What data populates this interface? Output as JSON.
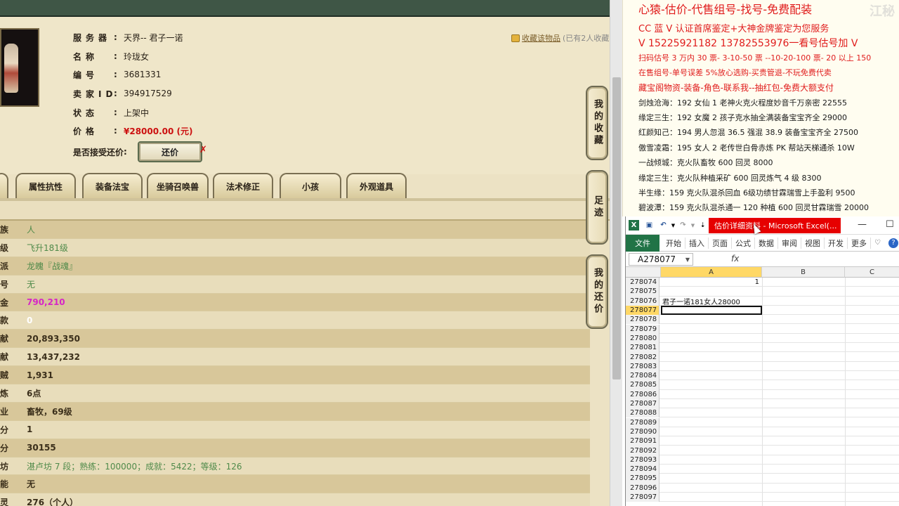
{
  "game": {
    "collect": {
      "link": "收藏该物品",
      "count": "(已有2人收藏"
    },
    "info": [
      {
        "label": "服务器",
        "value": "天界-- 君子一诺"
      },
      {
        "label": "名称",
        "value": "玲珑女"
      },
      {
        "label": "编号",
        "value": "3681331"
      },
      {
        "label": "卖家ID",
        "value": "394917529"
      },
      {
        "label": "状态",
        "value": "上架中"
      },
      {
        "label": "价格",
        "value": "¥28000.00 (元)"
      },
      {
        "label": "是否接受还价",
        "value": ""
      }
    ],
    "bargain_button": "还价",
    "bargain_close": "✗",
    "tabs": [
      "属性抗性",
      "装备法宝",
      "坐骑召唤兽",
      "法术修正",
      "小孩",
      "外观道具"
    ],
    "attributes": [
      {
        "label": "族",
        "value": "人"
      },
      {
        "label": "级",
        "value": "飞升181级"
      },
      {
        "label": "派",
        "value": "龙魄『战魂』"
      },
      {
        "label": "号",
        "value": "无"
      },
      {
        "label": "金",
        "value": "790,210"
      },
      {
        "label": "款",
        "value": "0"
      },
      {
        "label": "献",
        "value": "20,893,350"
      },
      {
        "label": "献",
        "value": "13,437,232"
      },
      {
        "label": "贼",
        "value": "1,931"
      },
      {
        "label": "炼",
        "value": "6点"
      },
      {
        "label": "业",
        "value": "畜牧，69级"
      },
      {
        "label": "分",
        "value": "1"
      },
      {
        "label": "分",
        "value": "30155"
      },
      {
        "label": "坊",
        "value": "湛卢坊 7 段；熟练：100000；成就：5422；等级：126"
      },
      {
        "label": "能",
        "value": "无"
      },
      {
        "label": "灵",
        "value": "276（个人）"
      }
    ],
    "side_buttons": [
      "我的收藏",
      "足迹",
      "我的还价"
    ]
  },
  "notes": {
    "watermark": "江秘",
    "lines": [
      "心猿-估价-代售组号-找号-免费配装",
      "CC 蓝 V 认证首席鉴定+大神金牌鉴定为您服务",
      "V 15225921182     13782553976一看号估号加 V",
      "扫码估号 3 万内 30 票- 3-10-50 票  --10-20-100 票- 20 以上 150",
      "在售组号-单号误差 5%放心选购-买贵管退-不玩免费代卖",
      "藏宝阁物资-装备-角色-联系我--抽红包-免费大额支付",
      "剑烛沧海：192 女仙 1 老神火克火程度妙音千万亲密 22555",
      "缘定三生：192 女魔 2 孩子克水抽全满装备宝宝齐全 29000",
      "红颜知己：194 男人忽混 36.5 强混 38.9 装备宝宝齐全 27500",
      "傲雪凌霜：195 女人 2 老传世白骨赤炼 PK 帮站天梯通杀 10W",
      "一战倾城：克火队畜牧 600 回灵 8000",
      "缘定三生：克火队种植采矿 600 回灵炼气 4 级 8300",
      "半生缘：159 克火队混杀回血 6级功绩甘霖瑞雪上手盈利 9500",
      "碧波潭：159 克火队混杀通一 120 种植 600 回灵甘霖瑞雪 20000"
    ]
  },
  "excel": {
    "title": "估价详细资料  -  Microsoft Excel(...",
    "ribbon": [
      "文件",
      "开始",
      "插入",
      "页面",
      "公式",
      "数据",
      "审阅",
      "视图",
      "开发",
      "更多"
    ],
    "name_box": "A278077",
    "fx": "fx",
    "columns": [
      "A",
      "B",
      "C"
    ],
    "rows": [
      {
        "num": "278074",
        "a": "1"
      },
      {
        "num": "278075",
        "a": ""
      },
      {
        "num": "278076",
        "a": "君子一诺181女人28000"
      },
      {
        "num": "278077",
        "a": ""
      },
      {
        "num": "278078",
        "a": ""
      },
      {
        "num": "278079",
        "a": ""
      },
      {
        "num": "278080",
        "a": ""
      },
      {
        "num": "278081",
        "a": ""
      },
      {
        "num": "278082",
        "a": ""
      },
      {
        "num": "278083",
        "a": ""
      },
      {
        "num": "278084",
        "a": ""
      },
      {
        "num": "278085",
        "a": ""
      },
      {
        "num": "278086",
        "a": ""
      },
      {
        "num": "278087",
        "a": ""
      },
      {
        "num": "278088",
        "a": ""
      },
      {
        "num": "278089",
        "a": ""
      },
      {
        "num": "278090",
        "a": ""
      },
      {
        "num": "278091",
        "a": ""
      },
      {
        "num": "278092",
        "a": ""
      },
      {
        "num": "278093",
        "a": ""
      },
      {
        "num": "278094",
        "a": ""
      },
      {
        "num": "278095",
        "a": ""
      },
      {
        "num": "278096",
        "a": ""
      },
      {
        "num": "278097",
        "a": ""
      }
    ],
    "window_controls": [
      "—",
      "☐"
    ]
  }
}
